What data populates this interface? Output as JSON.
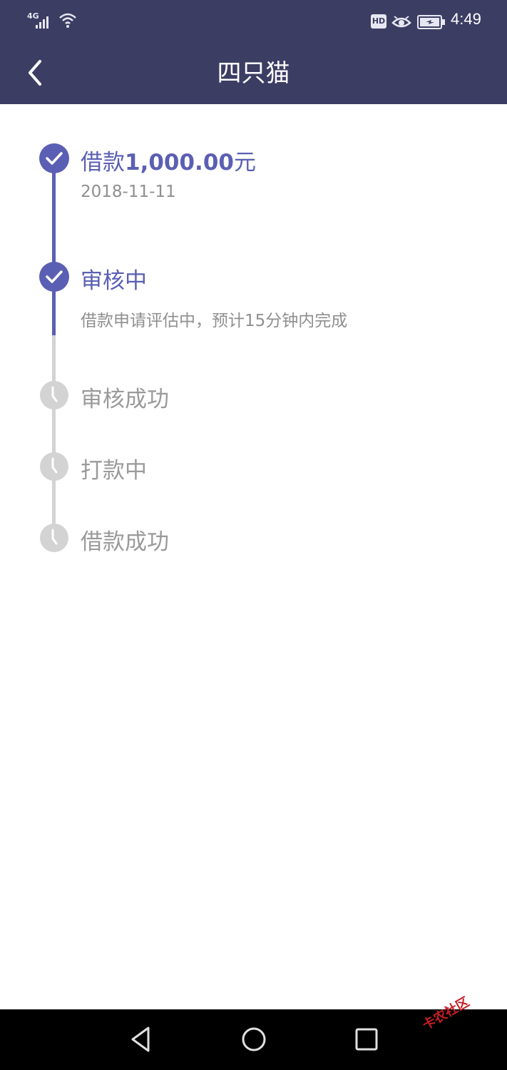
{
  "status_bar": {
    "network": "4G",
    "hd_badge": "HD",
    "time": "4:49",
    "icons": [
      "signal-icon",
      "wifi-icon",
      "hd-icon",
      "eye-icon",
      "battery-icon"
    ]
  },
  "header": {
    "title": "四只猫",
    "back_icon": "chevron-left-icon"
  },
  "colors": {
    "header_bg": "#3c3d63",
    "accent": "#5b5fb3",
    "inactive": "#d3d3d3",
    "muted_text": "#8f8f8f"
  },
  "timeline": {
    "steps": [
      {
        "label_prefix": "借款",
        "label_amount": "1,000.00",
        "label_suffix": "元",
        "sub": "2018-11-11",
        "state": "done"
      },
      {
        "label": "审核中",
        "sub": "借款申请评估中，预计15分钟内完成",
        "state": "done"
      },
      {
        "label": "审核成功",
        "state": "pending"
      },
      {
        "label": "打款中",
        "state": "pending"
      },
      {
        "label": "借款成功",
        "state": "pending"
      }
    ]
  },
  "navbar": {
    "icons": [
      "back-triangle-icon",
      "home-circle-icon",
      "recent-square-icon"
    ]
  },
  "watermark": "卡农社区"
}
